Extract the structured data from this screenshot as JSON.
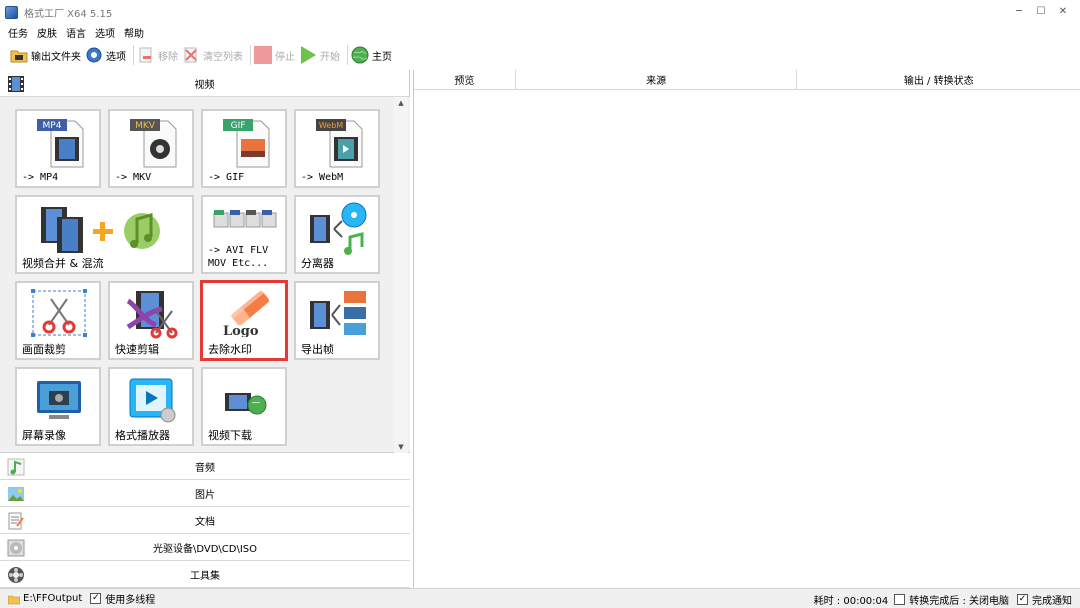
{
  "window": {
    "title": "格式工厂 X64 5.15"
  },
  "menu": [
    "任务",
    "皮肤",
    "语言",
    "选项",
    "帮助"
  ],
  "toolbar": {
    "output_folder": "输出文件夹",
    "options": "选项",
    "remove": "移除",
    "clear_list": "清空列表",
    "stop": "停止",
    "start": "开始",
    "home": "主页"
  },
  "categories": {
    "video": "视频",
    "audio": "音频",
    "image": "图片",
    "document": "文档",
    "disc": "光驱设备\\DVD\\CD\\ISO",
    "tools": "工具集"
  },
  "tiles": {
    "mp4": {
      "badge": "MP4",
      "label": "-> MP4"
    },
    "mkv": {
      "badge": "MKV",
      "label": "-> MKV"
    },
    "gif": {
      "badge": "GIF",
      "label": "-> GIF"
    },
    "webm": {
      "badge": "WebM",
      "label": "-> WebM"
    },
    "merge": {
      "label": "视频合并 & 混流"
    },
    "avi": {
      "label": "-> AVI FLV\nMOV Etc..."
    },
    "separator": {
      "label": "分离器"
    },
    "crop": {
      "label": "画面裁剪"
    },
    "quickcut": {
      "label": "快速剪辑"
    },
    "watermark": {
      "label": "去除水印",
      "logo": "Logo"
    },
    "frames": {
      "label": "导出帧"
    },
    "record": {
      "label": "屏幕录像"
    },
    "player": {
      "label": "格式播放器"
    },
    "download": {
      "label": "视频下载"
    }
  },
  "tasklist": {
    "columns": [
      "预览",
      "来源",
      "输出 / 转换状态"
    ]
  },
  "status": {
    "path": "E:\\FFOutput",
    "multithread": "使用多线程",
    "elapsed": "耗时 : 00:00:04",
    "after_done": "转换完成后 : 关闭电脑",
    "notify": "完成通知"
  },
  "colors": {
    "highlight": "#e53935",
    "play_green": "#6cc24a",
    "stop_red": "#ef9a9a"
  }
}
